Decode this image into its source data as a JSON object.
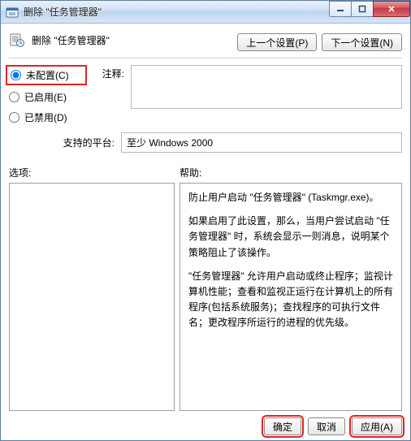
{
  "titlebar": {
    "title": "删除 \"任务管理器\""
  },
  "header": {
    "policy_title": "删除 \"任务管理器\"",
    "prev_btn": "上一个设置(P)",
    "next_btn": "下一个设置(N)"
  },
  "radios": {
    "not_configured": "未配置(C)",
    "enabled": "已启用(E)",
    "disabled": "已禁用(D)",
    "selected": "not_configured"
  },
  "comment": {
    "label": "注释:"
  },
  "platform": {
    "label": "支持的平台:",
    "value": "至少 Windows 2000"
  },
  "lower": {
    "options_label": "选项:",
    "help_label": "帮助:"
  },
  "help": {
    "p1": "防止用户启动 \"任务管理器\" (Taskmgr.exe)。",
    "p2": "如果启用了此设置，那么，当用户尝试启动 \"任务管理器\" 时，系统会显示一则消息，说明某个策略阻止了该操作。",
    "p3": "\"任务管理器\" 允许用户启动或终止程序；监视计算机性能；查看和监视正运行在计算机上的所有程序(包括系统服务)；查找程序的可执行文件名；更改程序所运行的进程的优先级。"
  },
  "footer": {
    "ok": "确定",
    "cancel": "取消",
    "apply": "应用(A)"
  }
}
